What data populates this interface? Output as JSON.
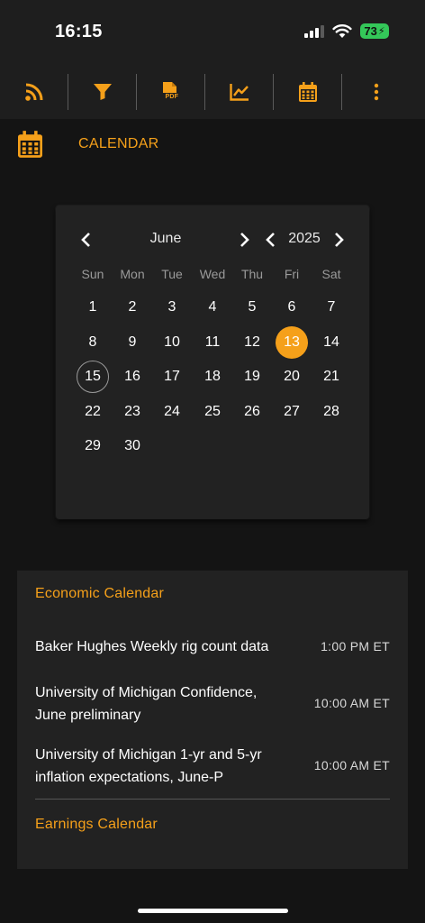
{
  "status_bar": {
    "time": "16:15",
    "battery": "73"
  },
  "toolbar": {
    "items": [
      {
        "icon": "rss-icon"
      },
      {
        "icon": "filter-icon"
      },
      {
        "icon": "pdf-icon",
        "label": "PDF"
      },
      {
        "icon": "line-chart-icon"
      },
      {
        "icon": "calendar-icon"
      },
      {
        "icon": "more-vertical-icon"
      }
    ]
  },
  "header": {
    "title": "CALENDAR"
  },
  "datepicker": {
    "month": "June",
    "year": "2025",
    "weekdays": [
      "Sun",
      "Mon",
      "Tue",
      "Wed",
      "Thu",
      "Fri",
      "Sat"
    ],
    "first_weekday_index": 0,
    "days_in_month": 30,
    "selected_day": 13,
    "today_day": 15
  },
  "events": {
    "economic_title": "Economic Calendar",
    "items": [
      {
        "name": "Baker Hughes Weekly rig count data",
        "time": "1:00 PM ET"
      },
      {
        "name": "University of Michigan Confidence, June preliminary",
        "time": "10:00 AM ET"
      },
      {
        "name": "University of Michigan 1-yr and 5-yr inflation expectations, June-P",
        "time": "10:00 AM ET"
      }
    ],
    "earnings_title": "Earnings Calendar"
  },
  "colors": {
    "accent": "#f5a01a",
    "background": "#141414",
    "panel": "#222222"
  }
}
